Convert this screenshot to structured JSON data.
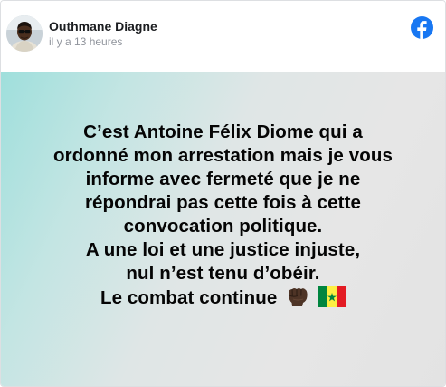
{
  "post": {
    "author": "Outhmane Diagne",
    "timestamp": "il y a 13 heures",
    "lines": [
      "C’est Antoine Félix Diome qui a",
      "ordonné mon arrestation mais je vous",
      "informe avec fermeté que je ne",
      "répondrai pas cette fois à cette",
      "convocation politique.",
      "A une loi et une justice injuste,",
      "nul n’est tenu d’obéir.",
      "Le combat continue"
    ],
    "emojis": [
      "raised-fist-dark-skin-icon",
      "senegal-flag-icon"
    ]
  },
  "brand": {
    "icon": "facebook-icon",
    "color": "#1877f2"
  },
  "colors": {
    "background_gradient_start": "#9fdfdc",
    "background_gradient_end": "#e3e3e3",
    "text": "#050505",
    "timestamp": "#90949c"
  }
}
